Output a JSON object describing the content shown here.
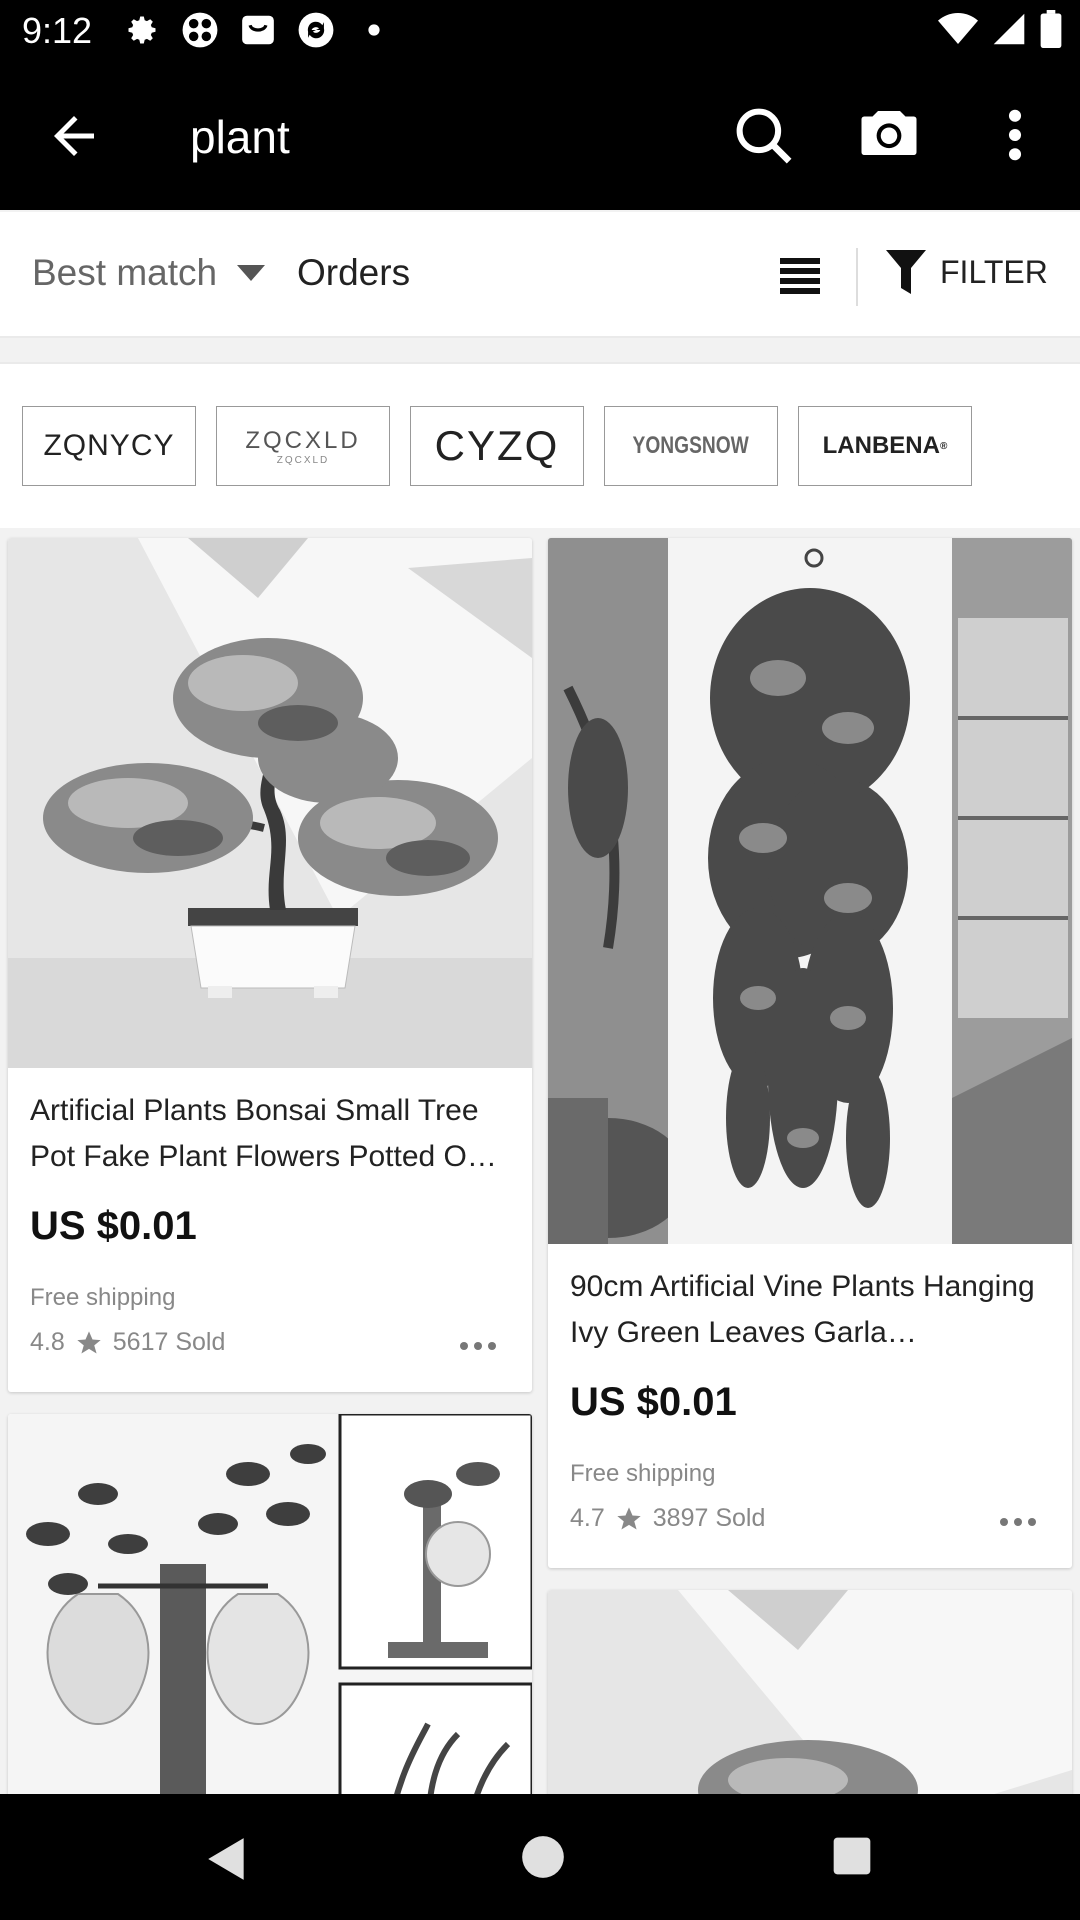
{
  "status_bar": {
    "time": "9:12"
  },
  "toolbar": {
    "query": "plant"
  },
  "sort_bar": {
    "best_match": "Best match",
    "orders": "Orders",
    "filter": "FILTER"
  },
  "brands": [
    "ZQNYCY",
    "ZQCXLD",
    "CYZQ",
    "YONGSNOW",
    "LANBENA"
  ],
  "brand_sub": "ZQCXLD",
  "brand_mark": "®",
  "products": [
    {
      "title": "Artificial Plants Bonsai Small Tree Pot Fake Plant Flowers Potted O…",
      "price": "US $0.01",
      "shipping": "Free shipping",
      "rating": "4.8",
      "sold": "5617 Sold"
    },
    {
      "title": "90cm Artificial Vine Plants Hanging Ivy Green Leaves Garla…",
      "price": "US $0.01",
      "shipping": "Free shipping",
      "rating": "4.7",
      "sold": "3897 Sold"
    }
  ]
}
